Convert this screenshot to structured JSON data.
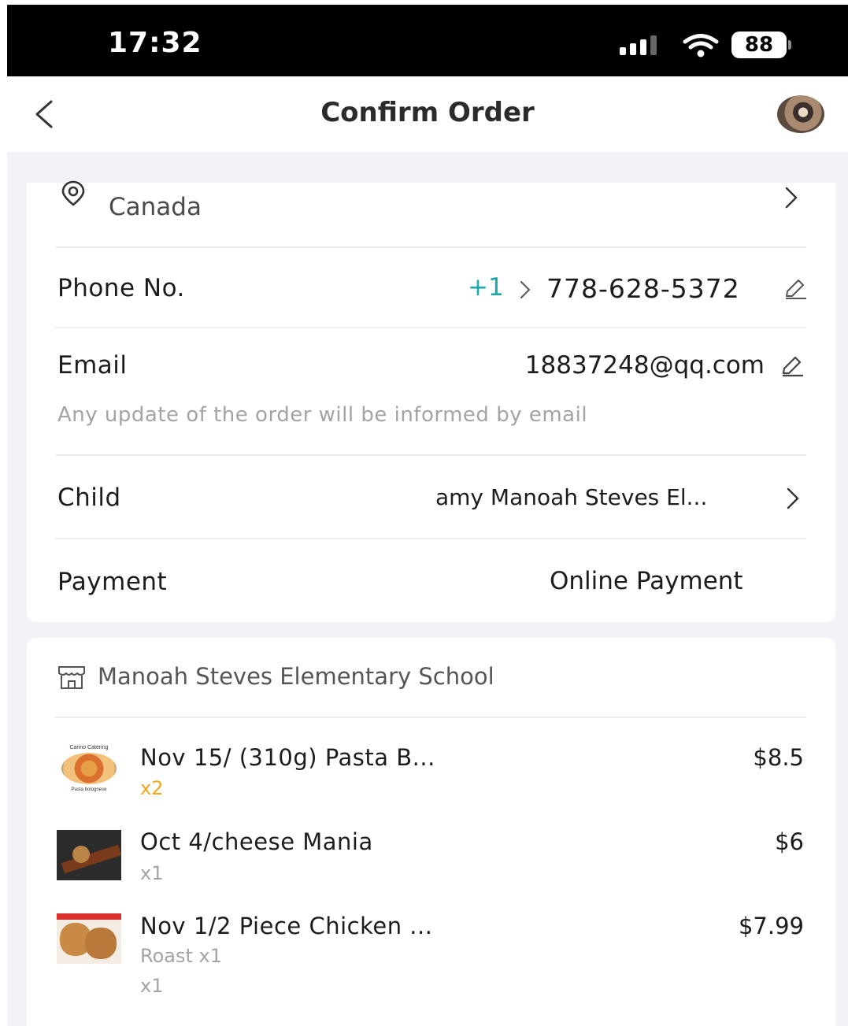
{
  "status_bar": {
    "time": "17:32",
    "battery": "88"
  },
  "header": {
    "title": "Confirm Order",
    "back_icon": "chevron-left-icon",
    "avatar": "user-avatar"
  },
  "address": {
    "text": "Canada",
    "icon": "location-pin-icon"
  },
  "phone": {
    "label": "Phone No.",
    "country_code": "+1",
    "number": "778-628-5372"
  },
  "email": {
    "label": "Email",
    "value": "18837248@qq.com",
    "hint": "Any update of the order will be informed by email"
  },
  "child": {
    "label": "Child",
    "value": "amy  Manoah Steves El..."
  },
  "payment": {
    "label": "Payment",
    "value": "Online Payment"
  },
  "store": {
    "name": "Manoah Steves Elementary School",
    "icon": "store-icon"
  },
  "items": [
    {
      "name": "Nov 15/ (310g) Pasta B...",
      "qty": "x2",
      "price": "$8.5",
      "thumb_caption_top": "Carino Catering",
      "thumb_caption_bottom": "Pasta bolognese"
    },
    {
      "name": "Oct 4/cheese Mania",
      "qty": "x1",
      "price": "$6"
    },
    {
      "name": "Nov 1/2 Piece Chicken ...",
      "sub": "Roast x1",
      "qty": "x1",
      "price": "$7.99"
    }
  ],
  "colors": {
    "accent_teal": "#1aa8a8",
    "qty_highlight": "#f0a81a",
    "muted_text": "#a3a3a8",
    "background": "#f3f3f7"
  }
}
